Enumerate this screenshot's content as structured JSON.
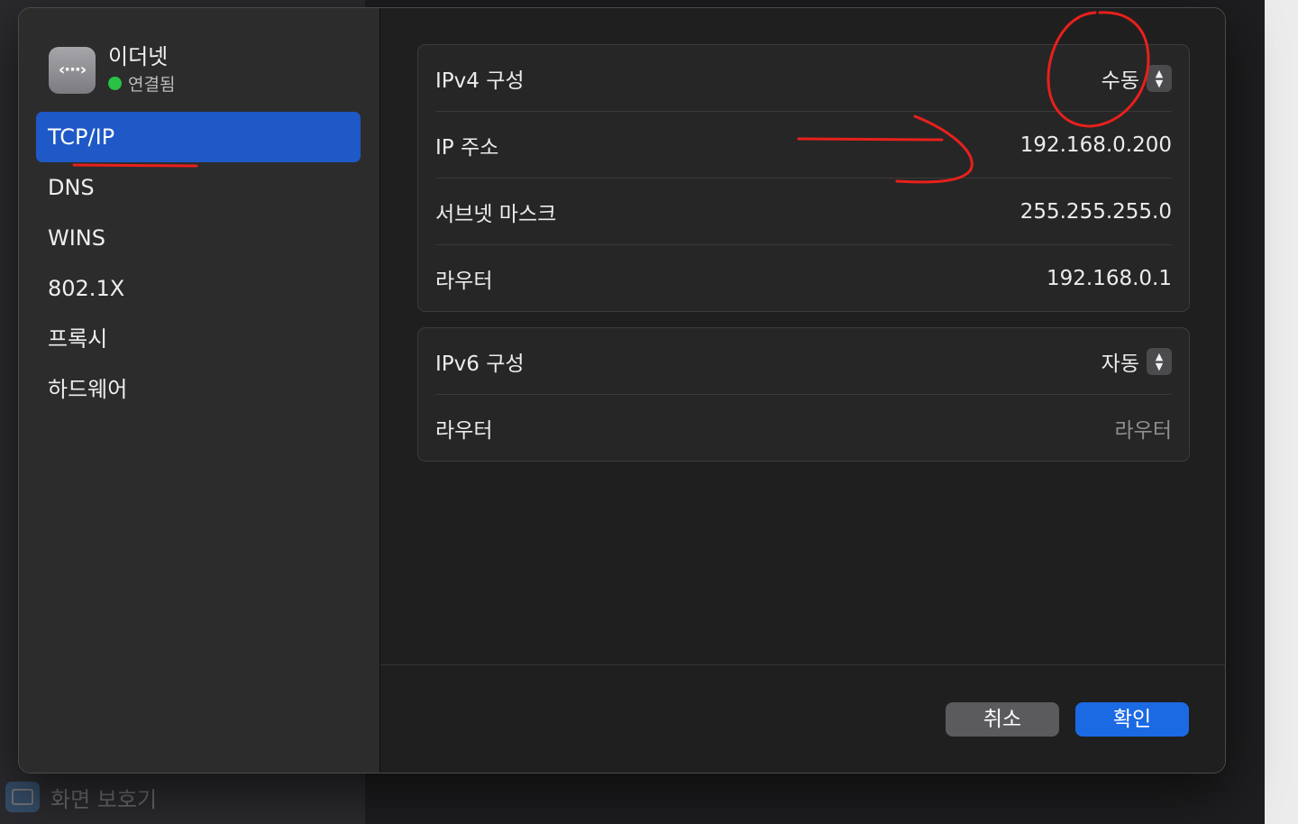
{
  "background": {
    "footer_item_label": "화면 보호기"
  },
  "header": {
    "title": "이더넷",
    "status": "연결됨",
    "icon_glyph": "‹···›"
  },
  "sidebar": {
    "items": [
      {
        "label": "TCP/IP"
      },
      {
        "label": "DNS"
      },
      {
        "label": "WINS"
      },
      {
        "label": "802.1X"
      },
      {
        "label": "프록시"
      },
      {
        "label": "하드웨어"
      }
    ]
  },
  "ipv4": {
    "config_label": "IPv4 구성",
    "config_value": "수동",
    "ip_label": "IP 주소",
    "ip_value": "192.168.0.200",
    "subnet_label": "서브넷 마스크",
    "subnet_value": "255.255.255.0",
    "router_label": "라우터",
    "router_value": "192.168.0.1"
  },
  "ipv6": {
    "config_label": "IPv6 구성",
    "config_value": "자동",
    "router_label": "라우터",
    "router_placeholder": "라우터"
  },
  "buttons": {
    "cancel": "취소",
    "ok": "확인"
  },
  "colors": {
    "accent": "#1f59c7",
    "ok_button": "#1b6ae4",
    "status_connected": "#29c244",
    "annotation": "#e8201c"
  }
}
